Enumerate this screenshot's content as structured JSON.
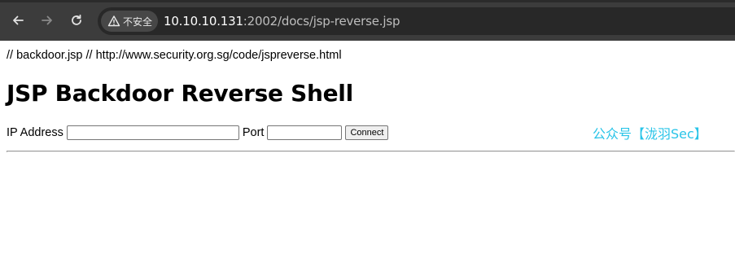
{
  "browser": {
    "nav": {
      "back_icon": "arrow-left-icon",
      "forward_icon": "arrow-right-icon",
      "reload_icon": "reload-icon"
    },
    "security_label": "不安全",
    "security_icon": "warning-triangle-icon",
    "url_host": "10.10.10.131",
    "url_rest": ":2002/docs/jsp-reverse.jsp"
  },
  "page": {
    "comment": "// backdoor.jsp // http://www.security.org.sg/code/jspreverse.html",
    "title": "JSP Backdoor Reverse Shell",
    "form": {
      "ip_label": "IP Address",
      "ip_value": "",
      "port_label": "Port",
      "port_value": "",
      "connect_label": "Connect"
    },
    "watermark": "公众号【泷羽Sec】"
  },
  "colors": {
    "toolbar_bg": "#3c3c3c",
    "omnibox_bg": "#282828",
    "watermark": "#29c4e8"
  }
}
